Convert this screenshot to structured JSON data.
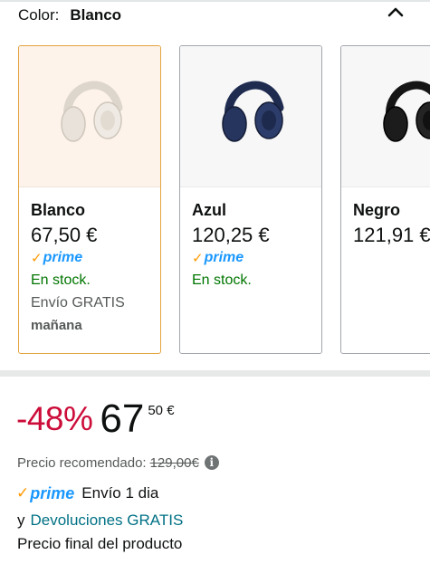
{
  "color_selector": {
    "label": "Color:",
    "selected_value": "Blanco",
    "collapse_icon": "chevron-up-icon"
  },
  "swatches": [
    {
      "name": "Blanco",
      "price": "67,50 €",
      "prime": "prime",
      "stock": "En stock.",
      "shipping": "Envío GRATIS",
      "shipping_day": "mañana",
      "selected": true,
      "headphone_color": "#e8e2da"
    },
    {
      "name": "Azul",
      "price": "120,25 €",
      "prime": "prime",
      "stock": "En stock.",
      "selected": false,
      "headphone_color": "#26355e"
    },
    {
      "name": "Negro",
      "price": "121,91 €",
      "selected": false,
      "headphone_color": "#1c1c1c"
    }
  ],
  "pricing": {
    "discount": "-48%",
    "price_whole": "67",
    "price_fraction": "50 €",
    "list_price_label": "Precio recomendado:",
    "list_price": "129,00€"
  },
  "delivery": {
    "prime": "prime",
    "text": "Envío 1 dia"
  },
  "returns": {
    "prefix": "y",
    "link": "Devoluciones GRATIS"
  },
  "final_price_note": "Precio final del producto",
  "colors": {
    "prime_blue": "#1a98ff",
    "prime_check": "#ff9900",
    "discount_red": "#cc0c39",
    "stock_green": "#007600",
    "link_teal": "#007185",
    "selected_border": "#e3a33f"
  }
}
